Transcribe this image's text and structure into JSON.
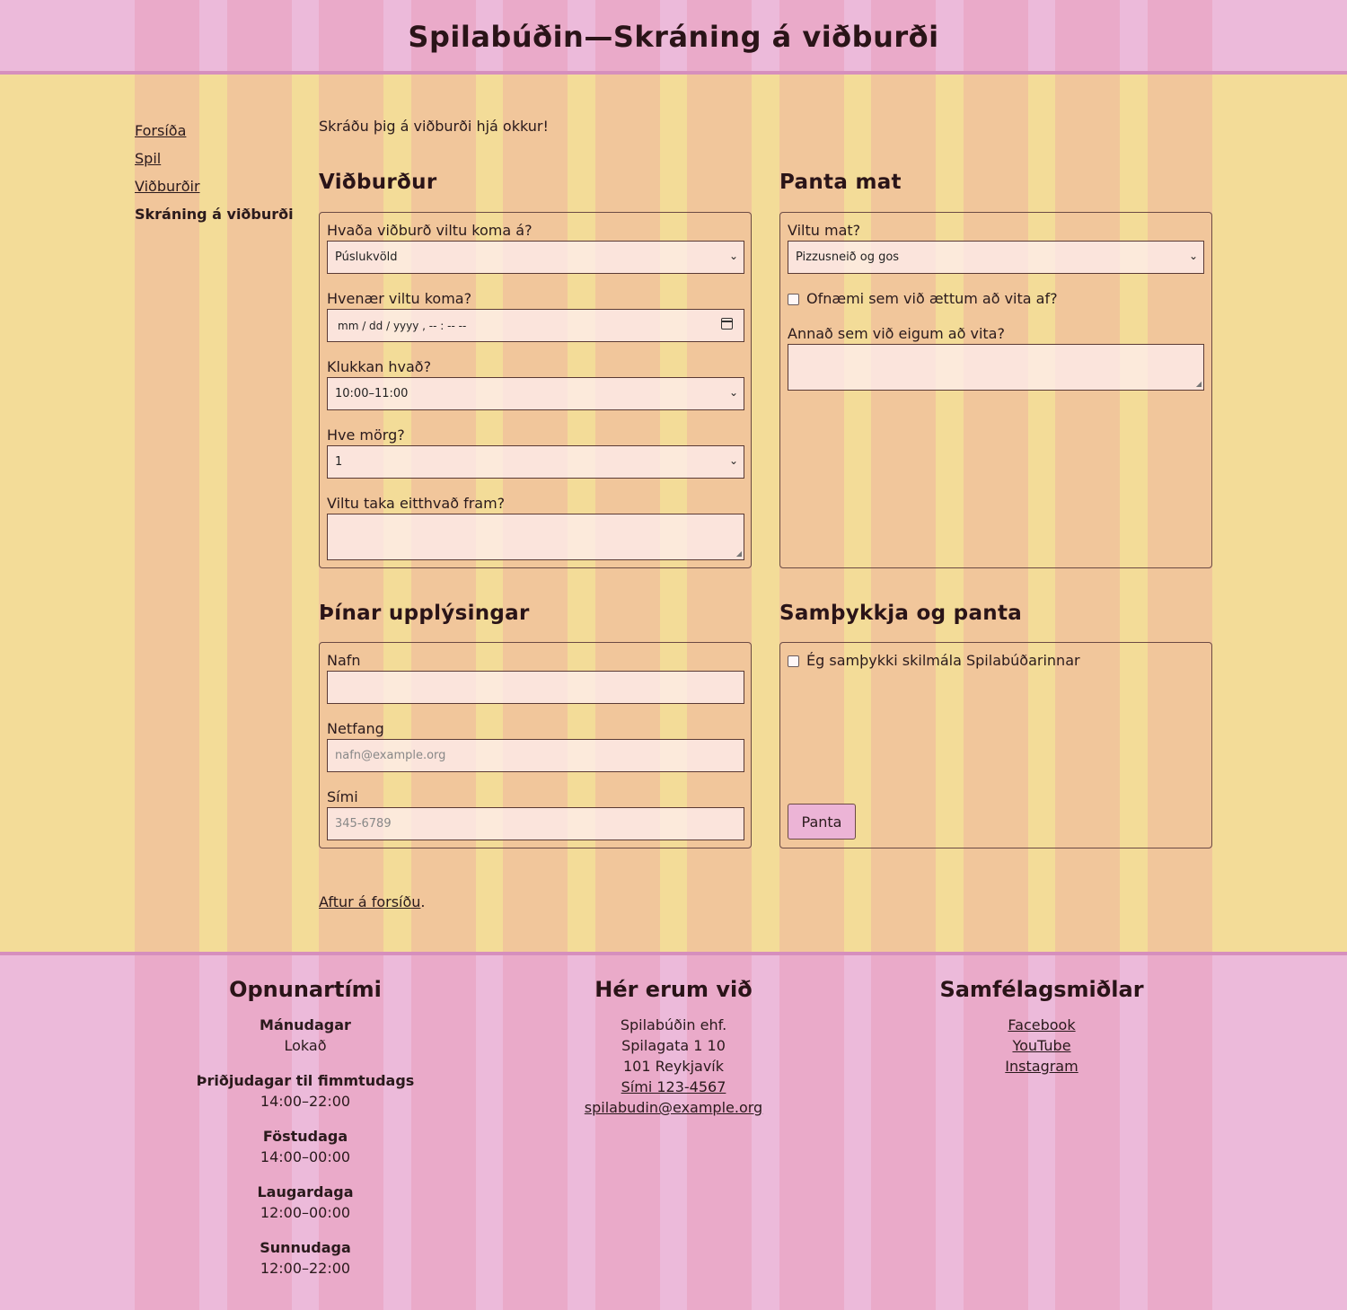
{
  "header": {
    "title": "Spilabúðin—Skráning á viðburði"
  },
  "nav": {
    "items": [
      {
        "label": "Forsíða"
      },
      {
        "label": "Spil"
      },
      {
        "label": "Viðburðir"
      },
      {
        "label": "Skráning á viðburði"
      }
    ]
  },
  "intro": "Skráðu þig á viðburði hjá okkur!",
  "event": {
    "heading": "Viðburður",
    "which_label": "Hvaða viðburð viltu koma á?",
    "which_value": "Púslukvöld",
    "when_label": "Hvenær viltu koma?",
    "when_placeholder": "mm / dd / yyyy ,  -- : --   --",
    "time_label": "Klukkan hvað?",
    "time_value": "10:00–11:00",
    "count_label": "Hve mörg?",
    "count_value": "1",
    "bring_label": "Viltu taka eitthvað fram?"
  },
  "food": {
    "heading": "Panta mat",
    "want_label": "Viltu mat?",
    "want_value": "Pizzusneið og gos",
    "allergy_label": "Ofnæmi sem við ættum að vita af?",
    "other_label": "Annað sem við eigum að vita?"
  },
  "info": {
    "heading": "Þínar upplýsingar",
    "name_label": "Nafn",
    "email_label": "Netfang",
    "email_placeholder": "nafn@example.org",
    "phone_label": "Sími",
    "phone_placeholder": "345-6789"
  },
  "confirm": {
    "heading": "Samþykkja og panta",
    "terms_label": "Ég samþykki skilmála Spilabúðarinnar",
    "submit_label": "Panta"
  },
  "back": {
    "link": "Aftur á forsíðu",
    "suffix": "."
  },
  "footer": {
    "hours": {
      "heading": "Opnunartími",
      "rows": [
        {
          "day": "Mánudagar",
          "time": "Lokað"
        },
        {
          "day": "Þriðjudagar til fimmtudags",
          "time": "14:00–22:00"
        },
        {
          "day": "Föstudaga",
          "time": "14:00–00:00"
        },
        {
          "day": "Laugardaga",
          "time": "12:00–00:00"
        },
        {
          "day": "Sunnudaga",
          "time": "12:00–22:00"
        }
      ]
    },
    "location": {
      "heading": "Hér erum við",
      "company": "Spilabúðin ehf.",
      "street": "Spilagata 1 10",
      "city": "101 Reykjavík",
      "phone": "Sími 123-4567",
      "email": "spilabudin@example.org"
    },
    "social": {
      "heading": "Samfélagsmiðlar",
      "links": [
        "Facebook",
        "YouTube",
        "Instagram"
      ]
    }
  },
  "colors": {
    "header_bg": "#ecbada",
    "main_bg": "#f3dc98",
    "accent_line": "#d68fbd",
    "button_bg": "#ecb4d6"
  }
}
